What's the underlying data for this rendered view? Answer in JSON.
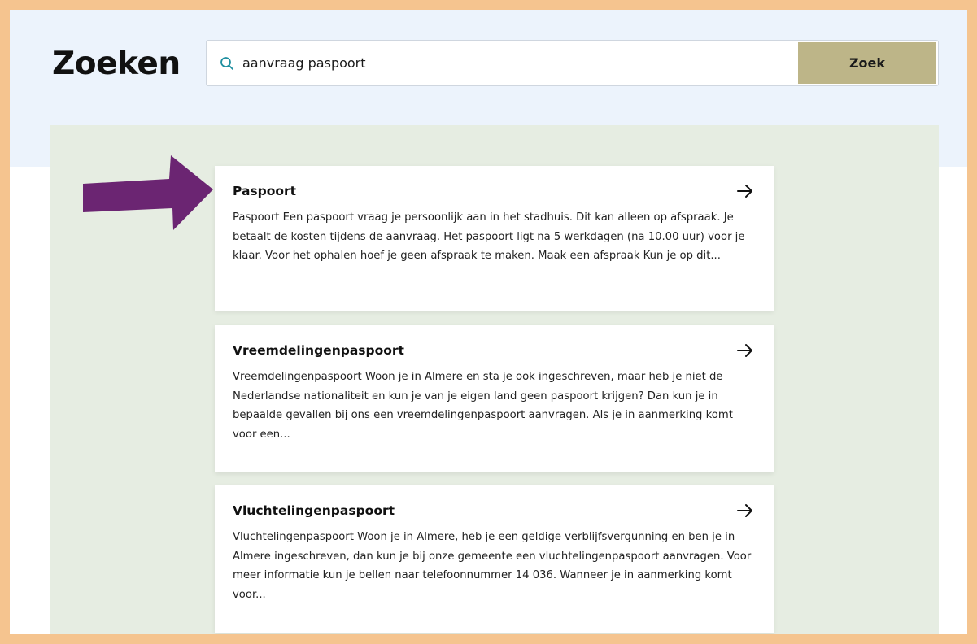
{
  "page": {
    "title": "Zoeken"
  },
  "search": {
    "value": "aanvraag paspoort",
    "placeholder": "",
    "button_label": "Zoek",
    "icon": "search-icon"
  },
  "results": [
    {
      "title": "Paspoort",
      "text": "Paspoort Een paspoort vraag je persoonlijk aan in het stadhuis. Dit kan alleen op afspraak. Je betaalt de kosten tijdens de aanvraag. Het paspoort ligt na 5 werkdagen (na 10.00 uur) voor je klaar. Voor het ophalen hoef je geen afspraak te maken. Maak een afspraak Kun je op dit...",
      "icon": "arrow-right-icon"
    },
    {
      "title": "Vreemdelingenpaspoort",
      "text": "Vreemdelingenpaspoort Woon je in Almere en sta je ook ingeschreven, maar heb je niet de Nederlandse nationaliteit en kun je van je eigen land geen paspoort krijgen? Dan kun je in bepaalde gevallen bij ons een vreemdelingenpaspoort aanvragen. Als je in aanmerking komt voor een...",
      "icon": "arrow-right-icon"
    },
    {
      "title": "Vluchtelingenpaspoort",
      "text": "Vluchtelingenpaspoort Woon je in Almere, heb je een geldige verblijfsvergunning en ben je in Almere ingeschreven, dan kun je bij onze gemeente een vluchtelingenpaspoort aanvragen. Voor meer informatie kun je bellen naar telefoonnummer 14 036. Wanneer je in aanmerking komt voor...",
      "icon": "arrow-right-icon"
    }
  ],
  "colors": {
    "frame_border": "#f5c48f",
    "top_band": "#ecf3fc",
    "results_panel": "#e6ede2",
    "search_button": "#bdb588",
    "pointer_arrow": "#6b2572",
    "search_icon": "#1f8fa0"
  },
  "annotation": {
    "icon": "pointer-arrow-icon"
  }
}
